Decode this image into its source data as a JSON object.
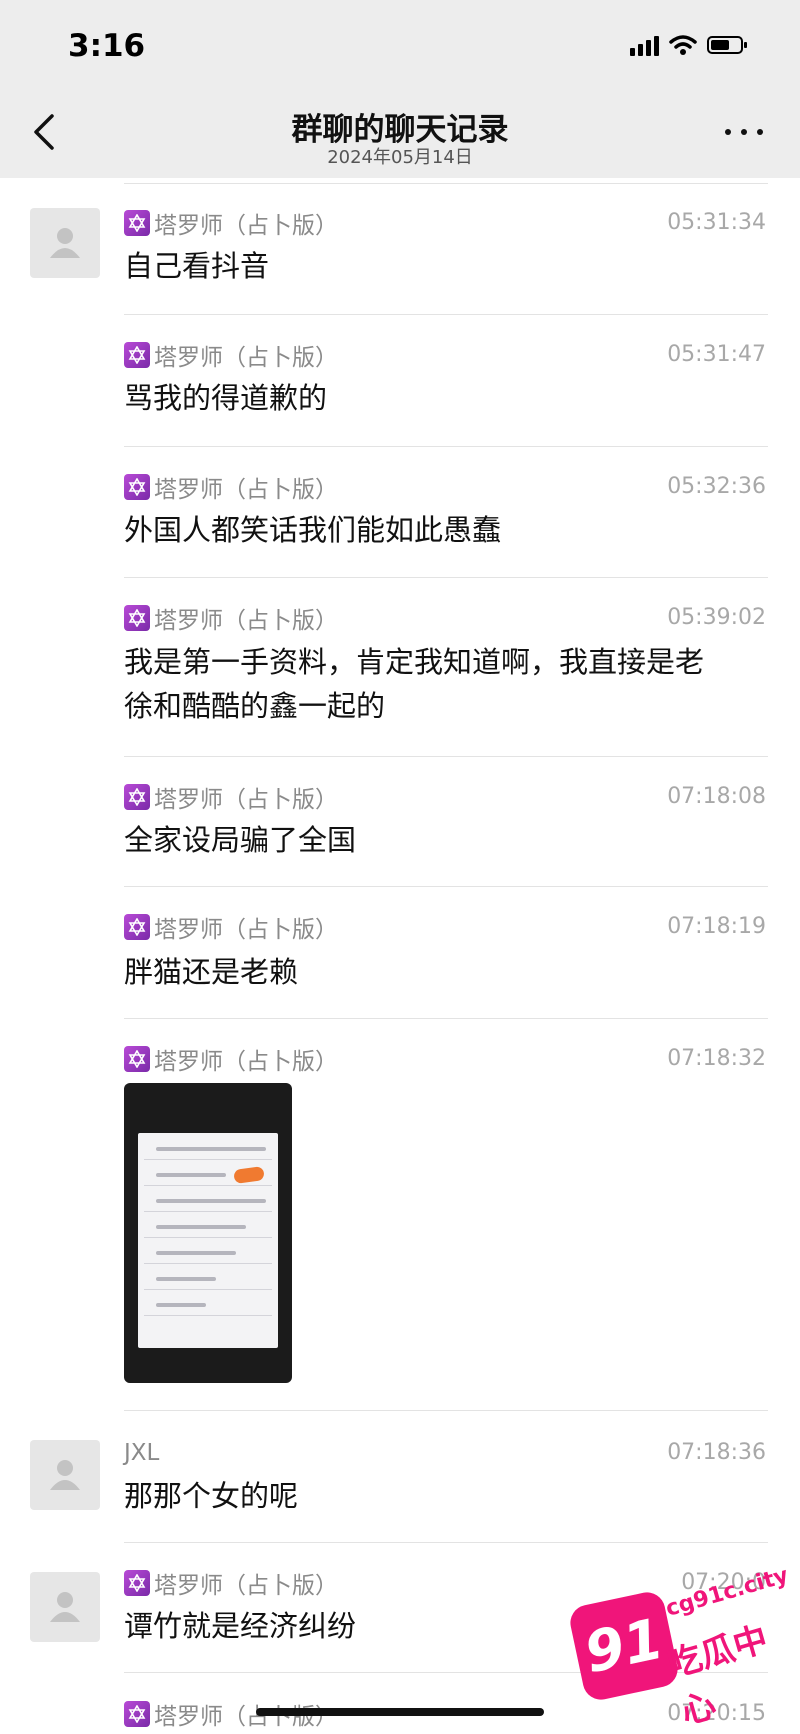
{
  "status_bar": {
    "time": "3:16"
  },
  "nav": {
    "title": "群聊的聊天记录",
    "subtitle": "2024年05月14日"
  },
  "messages": [
    {
      "sender": "塔罗师（占卜版）",
      "time": "05:31:34",
      "text": "自己看抖音",
      "avatar": true,
      "badge": true
    },
    {
      "sender": "塔罗师（占卜版）",
      "time": "05:31:47",
      "text": "骂我的得道歉的",
      "avatar": false,
      "badge": true
    },
    {
      "sender": "塔罗师（占卜版）",
      "time": "05:32:36",
      "text": "外国人都笑话我们能如此愚蠢",
      "avatar": false,
      "badge": true
    },
    {
      "sender": "塔罗师（占卜版）",
      "time": "05:39:02",
      "text_line1": "我是第一手资料，肯定我知道啊，我直接是老",
      "text_line2": "徐和酷酷的鑫一起的",
      "avatar": false,
      "badge": true
    },
    {
      "sender": "塔罗师（占卜版）",
      "time": "07:18:08",
      "text": "全家设局骗了全国",
      "avatar": false,
      "badge": true
    },
    {
      "sender": "塔罗师（占卜版）",
      "time": "07:18:19",
      "text": "胖猫还是老赖",
      "avatar": false,
      "badge": true
    },
    {
      "sender": "塔罗师（占卜版）",
      "time": "07:18:32",
      "image": true,
      "avatar": false,
      "badge": true
    },
    {
      "sender": "JXL",
      "time": "07:18:36",
      "text": "那那个女的呢",
      "avatar": true,
      "badge": false
    },
    {
      "sender": "塔罗师（占卜版）",
      "time": "07:20:0",
      "text": "谭竹就是经济纠纷",
      "avatar": true,
      "badge": true
    },
    {
      "sender": "塔罗师（占卜版）",
      "time": "07:20:15",
      "avatar": false,
      "badge": true
    }
  ],
  "watermark": {
    "number": "91",
    "url": "cg91c.city",
    "brand": "吃瓜中心"
  },
  "icons": {
    "back": "chevron-left-icon",
    "more": "more-dots-icon",
    "avatar": "default-avatar-icon",
    "badge": "star-of-david-badge-icon"
  },
  "colors": {
    "header_bg": "#ededed",
    "secondary_text": "#8a8a8a",
    "badge": "#9b3cc4",
    "watermark": "#f0157a"
  }
}
